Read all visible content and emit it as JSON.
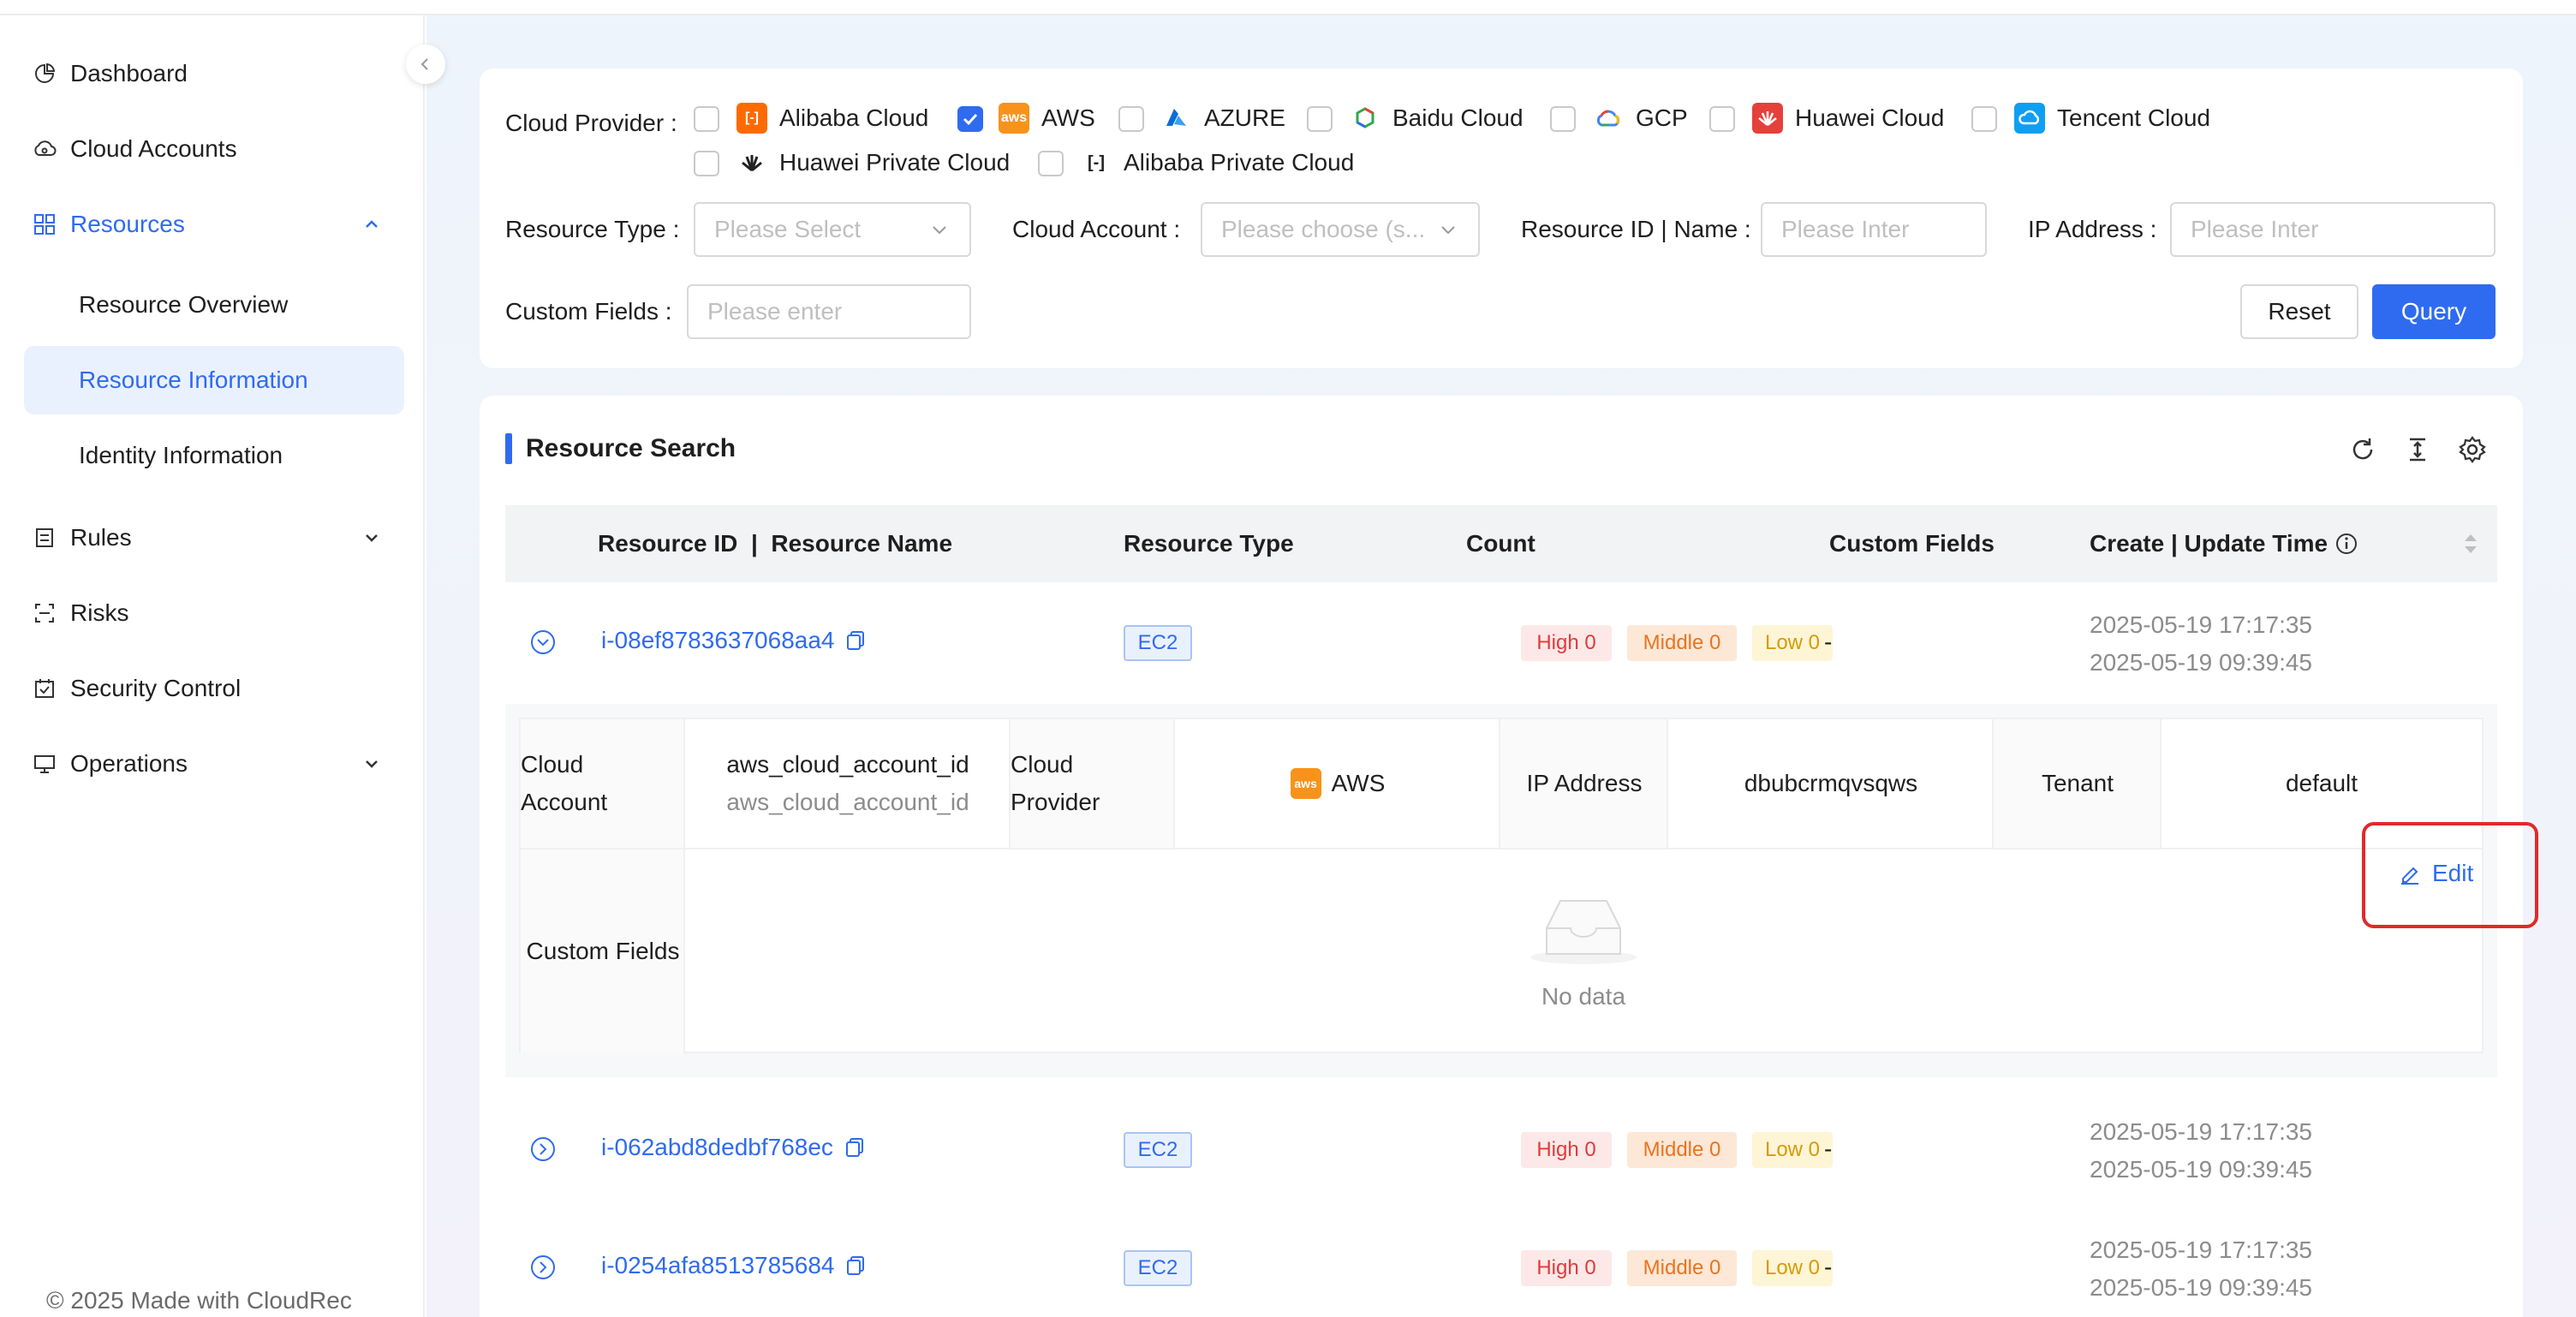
{
  "sidebar": {
    "items": [
      {
        "label": "Dashboard",
        "icon": "pie-chart-icon"
      },
      {
        "label": "Cloud Accounts",
        "icon": "cloud-icon"
      },
      {
        "label": "Resources",
        "icon": "grid-icon"
      },
      {
        "label": "Rules",
        "icon": "rules-icon"
      },
      {
        "label": "Risks",
        "icon": "risk-icon"
      },
      {
        "label": "Security Control",
        "icon": "security-icon"
      },
      {
        "label": "Operations",
        "icon": "monitor-icon"
      }
    ],
    "sub_items": [
      "Resource Overview",
      "Resource Information",
      "Identity Information"
    ],
    "footer": "© 2025 Made with CloudRec"
  },
  "filters": {
    "cloud_provider_label": "Cloud Provider",
    "providers": [
      {
        "name": "Alibaba Cloud",
        "checked": false
      },
      {
        "name": "AWS",
        "checked": true
      },
      {
        "name": "AZURE",
        "checked": false
      },
      {
        "name": "Baidu Cloud",
        "checked": false
      },
      {
        "name": "GCP",
        "checked": false
      },
      {
        "name": "Huawei Cloud",
        "checked": false
      },
      {
        "name": "Tencent Cloud",
        "checked": false
      },
      {
        "name": "Huawei Private Cloud",
        "checked": false
      },
      {
        "name": "Alibaba Private Cloud",
        "checked": false
      }
    ],
    "resource_type_label": "Resource Type",
    "resource_type_placeholder": "Please Select",
    "cloud_account_label": "Cloud Account",
    "cloud_account_placeholder": "Please choose (s...",
    "resource_id_label": "Resource ID | Name",
    "resource_id_placeholder": "Please Inter",
    "ip_label": "IP Address",
    "ip_placeholder": "Please Inter",
    "custom_fields_label": "Custom Fields",
    "custom_fields_placeholder": "Please enter",
    "reset_label": "Reset",
    "query_label": "Query"
  },
  "results": {
    "title": "Resource Search",
    "columns": [
      "Resource ID",
      "Resource Name",
      "Resource Type",
      "Count",
      "Custom Fields",
      "Create | Update Time"
    ],
    "column_separator": "|",
    "rows": [
      {
        "id": "i-08ef8783637068aa4",
        "type": "EC2",
        "high": "High 0",
        "middle": "Middle 0",
        "low": "Low 0",
        "custom": "-",
        "created": "2025-05-19 17:17:35",
        "updated": "2025-05-19 09:39:45",
        "expanded": true
      },
      {
        "id": "i-062abd8dedbf768ec",
        "type": "EC2",
        "high": "High 0",
        "middle": "Middle 0",
        "low": "Low 0",
        "custom": "-",
        "created": "2025-05-19 17:17:35",
        "updated": "2025-05-19 09:39:45",
        "expanded": false
      },
      {
        "id": "i-0254afa8513785684",
        "type": "EC2",
        "high": "High 0",
        "middle": "Middle 0",
        "low": "Low 0",
        "custom": "-",
        "created": "2025-05-19 17:17:35",
        "updated": "2025-05-19 09:39:45",
        "expanded": false
      }
    ],
    "detail": {
      "cloud_account_label_1": "Cloud",
      "cloud_account_label_2": "Account",
      "cloud_account_value": "aws_cloud_account_id",
      "cloud_account_sub": "aws_cloud_account_id",
      "cloud_provider_label_1": "Cloud",
      "cloud_provider_label_2": "Provider",
      "cloud_provider_value": "AWS",
      "ip_label": "IP Address",
      "ip_value": "dbubcrmqvsqws",
      "tenant_label": "Tenant",
      "tenant_value": "default",
      "custom_fields_label": "Custom Fields",
      "empty_text": "No data",
      "edit_label": "Edit"
    }
  },
  "colors": {
    "primary": "#2f6bf0",
    "aws": "#f7931a",
    "alibaba": "#ff6a00",
    "huawei": "#e5413b",
    "tencent": "#0f9ff2",
    "highlight": "#e02a2a"
  }
}
